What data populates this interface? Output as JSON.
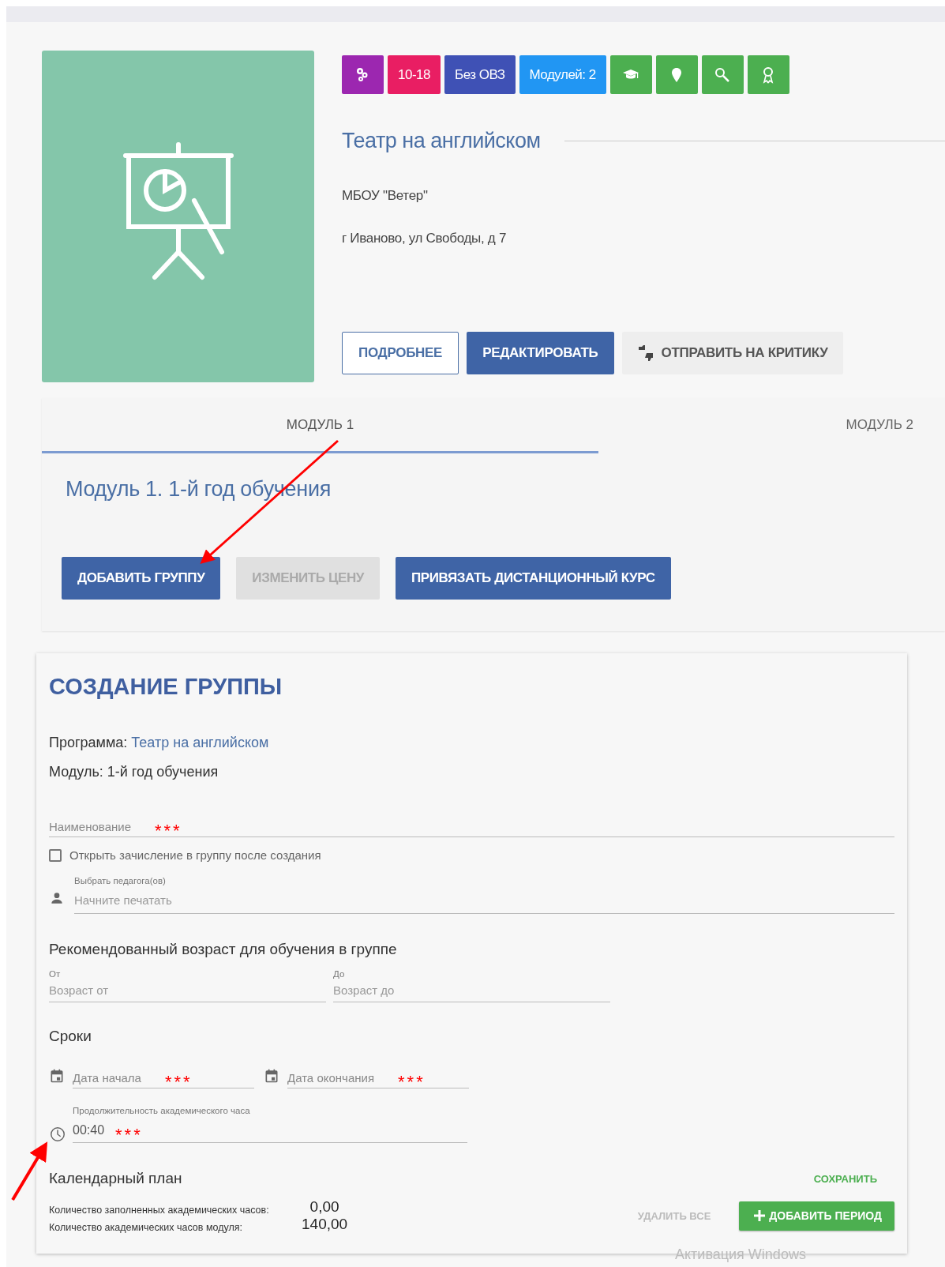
{
  "program": {
    "badges": [
      {
        "kind": "icon",
        "color": "#9c27b0"
      },
      {
        "kind": "text",
        "label": "10-18",
        "color": "#e91e63"
      },
      {
        "kind": "text",
        "label": "Без ОВЗ",
        "color": "#3f51b5"
      },
      {
        "kind": "text",
        "label": "Модулей: 2",
        "color": "#2196f3"
      },
      {
        "kind": "icon",
        "color": "#4caf50"
      },
      {
        "kind": "icon",
        "color": "#4caf50"
      },
      {
        "kind": "icon",
        "color": "#4caf50"
      },
      {
        "kind": "icon",
        "color": "#4caf50"
      }
    ],
    "title": "Театр на английском",
    "organization": "МБОУ \"Ветер\"",
    "address": "г Иваново, ул Свободы, д 7",
    "buttons": [
      {
        "label": "ПОДРОБНЕЕ",
        "kind": "outline"
      },
      {
        "label": "РЕДАКТИРОВАТЬ",
        "kind": "primary"
      },
      {
        "label": "ОТПРАВИТЬ НА КРИТИКУ",
        "kind": "flat"
      }
    ]
  },
  "tabs": [
    {
      "label": "МОДУЛЬ 1",
      "selected": true
    },
    {
      "label": "МОДУЛЬ 2",
      "selected": false
    }
  ],
  "module": {
    "heading": "Модуль 1. 1-й год обучения",
    "buttons": [
      {
        "label": "ДОБАВИТЬ ГРУППУ",
        "disabled": false
      },
      {
        "label": "ИЗМЕНИТЬ ЦЕНУ",
        "disabled": true
      },
      {
        "label": "ПРИВЯЗАТЬ ДИСТАНЦИОННЫЙ КУРС",
        "disabled": false
      }
    ]
  },
  "form": {
    "title": "СОЗДАНИЕ ГРУППЫ",
    "program_label": "Программа:",
    "program_link": "Театр на английском",
    "module_line": "Модуль: 1-й год обучения",
    "name_field": {
      "placeholder": "Наименование",
      "required_mark": "***"
    },
    "enroll_checkbox": {
      "label": "Открыть зачисление в группу после создания",
      "checked": false
    },
    "teacher_field": {
      "label": "Выбрать педагога(ов)",
      "placeholder": "Начните печатать"
    },
    "age_heading": "Рекомендованный возраст для обучения в группе",
    "age_fields": [
      {
        "label": "От",
        "placeholder": "Возраст от"
      },
      {
        "label": "До",
        "placeholder": "Возраст до"
      }
    ],
    "dates_heading": "Сроки",
    "date_fields": [
      {
        "placeholder": "Дата начала",
        "required_mark": "***"
      },
      {
        "placeholder": "Дата окончания",
        "required_mark": "***"
      }
    ],
    "duration_field": {
      "label": "Продолжительность академического часа",
      "value": "00:40",
      "required_mark": "***"
    },
    "plan": {
      "title": "Календарный план",
      "save": "СОХРАНИТЬ",
      "stats": [
        {
          "label": "Количество заполненных академических часов:",
          "value": "0,00"
        },
        {
          "label": "Количество академических часов модуля:",
          "value": "140,00"
        }
      ],
      "delete_all": {
        "label": "УДАЛИТЬ ВСЕ",
        "disabled": true
      },
      "add_period": "ДОБАВИТЬ ПЕРИОД"
    }
  },
  "os_notice": "Активация Windows"
}
